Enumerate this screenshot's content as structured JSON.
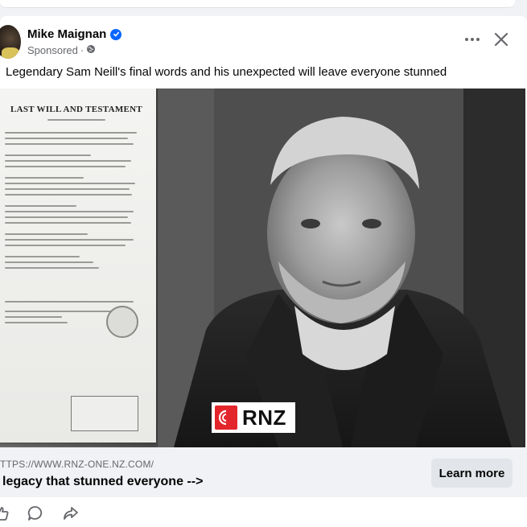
{
  "post": {
    "author": "Mike Maignan",
    "sponsored_label": "Sponsored",
    "caption": "Legendary Sam Neill's final words and his unexpected will leave everyone stunned"
  },
  "media": {
    "document_title": "LAST WILL AND TESTAMENT",
    "logo_text": "RNZ"
  },
  "link": {
    "url": "TTPS://WWW.RNZ-ONE.NZ.COM/",
    "headline": "legacy that stunned everyone -->",
    "cta_label": "Learn more"
  },
  "icons": {
    "verified": "verified-badge-icon",
    "privacy": "globe-icon",
    "more": "more-options-icon",
    "close": "close-icon",
    "like": "like-icon",
    "comment": "comment-icon",
    "share": "share-icon"
  },
  "colors": {
    "brand_blue": "#0866ff",
    "rnz_red": "#e3262b",
    "secondary_text": "#65676b",
    "button_bg": "#e2e5e9"
  }
}
